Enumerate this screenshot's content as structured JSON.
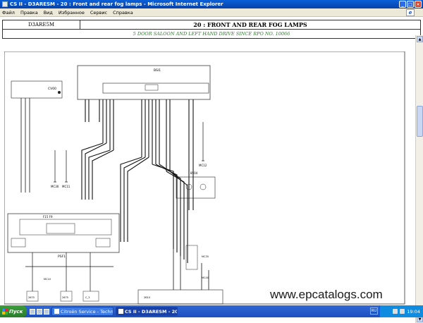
{
  "window": {
    "title": "CS II - D3ARESM - 20 : Front and rear fog lamps - Microsoft Internet Explorer",
    "minimize": "_",
    "maximize": "□",
    "close": "×"
  },
  "menubar": {
    "items": [
      {
        "label": "Файл"
      },
      {
        "label": "Правка"
      },
      {
        "label": "Вид"
      },
      {
        "label": "Избранное"
      },
      {
        "label": "Сервис"
      },
      {
        "label": "Справка"
      }
    ],
    "logo": "e"
  },
  "header": {
    "ref": "D3ARE5M",
    "title": "20 : FRONT AND REAR FOG LAMPS",
    "subtitle": "5 DOOR SALOON AND LEFT HAND DRIVE SINCE RPO NO. 10066"
  },
  "diagram": {
    "labels": {
      "bsi": "BSI1",
      "cv00": "CV00",
      "p": "P",
      "psf1": "PSF1",
      "bsm": "BSM",
      "mc30": "MC30",
      "mc11": "MC11",
      "mc12": "MC12",
      "es04": "8504",
      "mc10": "MC10",
      "c_3": "C_3",
      "fu": "F15  F9",
      "e20": "2670",
      "e21": "2675",
      "mc35": "MC35",
      "mc40": "MC40",
      "e31": "2B10"
    }
  },
  "watermark": "www.epcatalogs.com",
  "taskbar": {
    "start": "Пуск",
    "tasks": [
      {
        "label": "Citroën Service - Technic..."
      },
      {
        "label": "CS II - D3ARESM - 20 :..."
      }
    ],
    "lang": "RU",
    "clock": "19:04"
  },
  "colors": {
    "titlebar": "#0842a8",
    "subtitle_green": "#2a7d2a",
    "taskbar": "#1c4fc0",
    "start": "#2a7d2a"
  }
}
